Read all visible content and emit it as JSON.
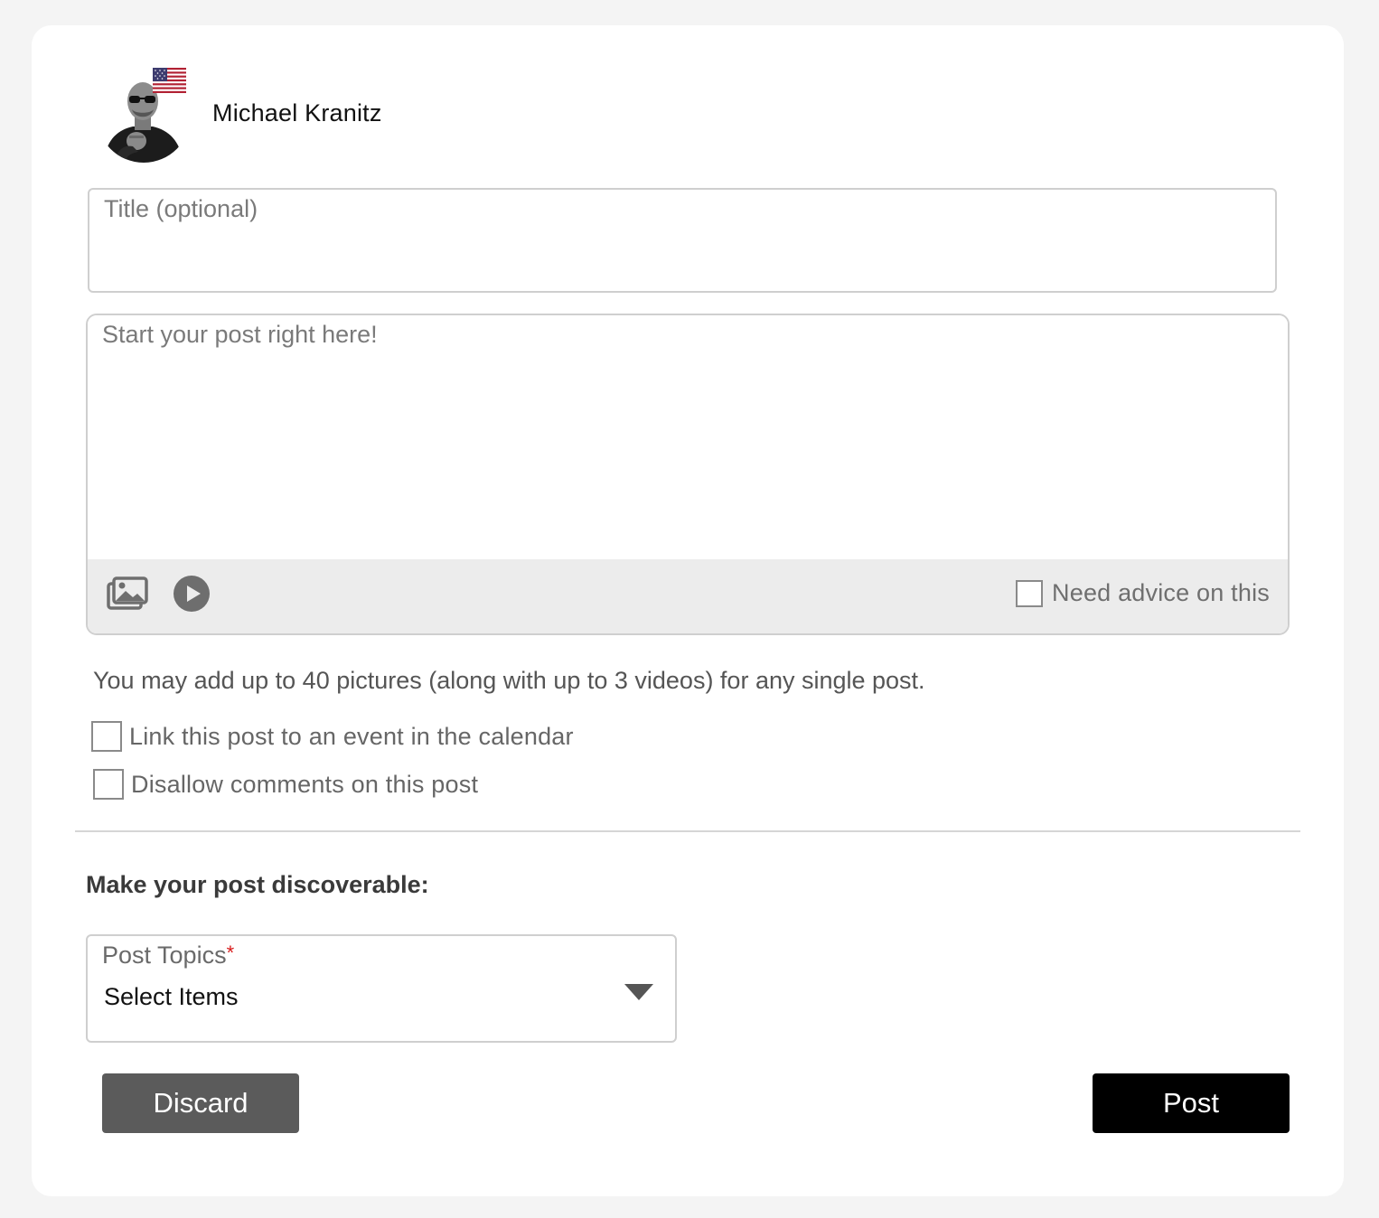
{
  "user": {
    "name": "Michael Kranitz",
    "avatar_icon": "user-avatar-photo",
    "flag_icon": "us-flag-icon"
  },
  "composer": {
    "title_placeholder": "Title (optional)",
    "title_value": "",
    "body_placeholder": "Start your post right here!",
    "body_value": "",
    "toolbar": {
      "photo_icon": "photo-gallery-icon",
      "video_icon": "play-video-icon",
      "advice_label": "Need advice on this",
      "advice_checked": false
    }
  },
  "info_text": "You may add up to 40 pictures (along with up to 3 videos) for any single post.",
  "options": {
    "link_event_label": "Link this post to an event in the calendar",
    "link_event_checked": false,
    "disallow_comments_label": "Disallow comments on this post",
    "disallow_comments_checked": false
  },
  "discover": {
    "heading": "Make your post discoverable:",
    "topics_label": "Post Topics",
    "topics_required_mark": "*",
    "topics_value": "Select Items"
  },
  "actions": {
    "discard_label": "Discard",
    "post_label": "Post"
  },
  "colors": {
    "post_button": "#000000",
    "discard_button": "#5b5b5b",
    "required_mark": "#d81b1b",
    "toolbar_bg": "#ececec"
  }
}
